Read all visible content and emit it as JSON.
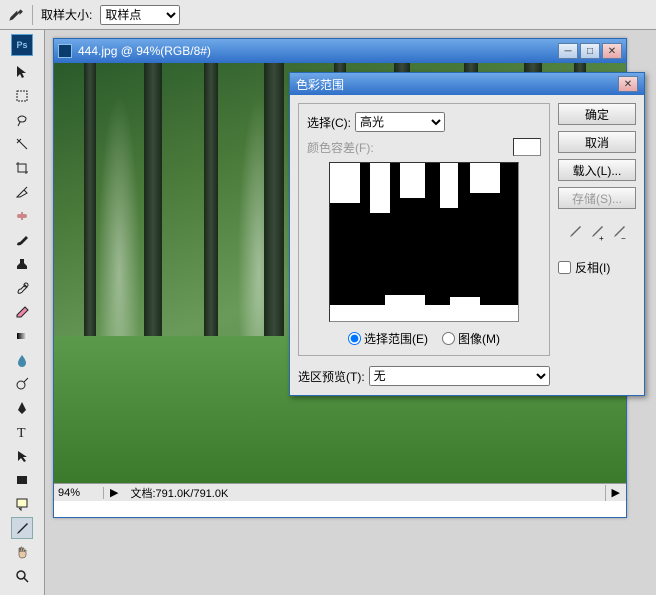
{
  "top": {
    "sample_label": "取样大小:",
    "sample_value": "取样点"
  },
  "doc": {
    "title": "444.jpg @ 94%(RGB/8#)",
    "zoom": "94%",
    "docsize_label": "文档:",
    "docsize": "791.0K/791.0K"
  },
  "dialog": {
    "title": "色彩范围",
    "select_label": "选择(C):",
    "select_value": "高光",
    "fuzziness_label": "颜色容差(F):",
    "radio_range": "选择范围(E)",
    "radio_image": "图像(M)",
    "preview_label": "选区预览(T):",
    "preview_value": "无",
    "ok": "确定",
    "cancel": "取消",
    "load": "载入(L)...",
    "save": "存储(S)...",
    "invert": "反相(I)"
  }
}
